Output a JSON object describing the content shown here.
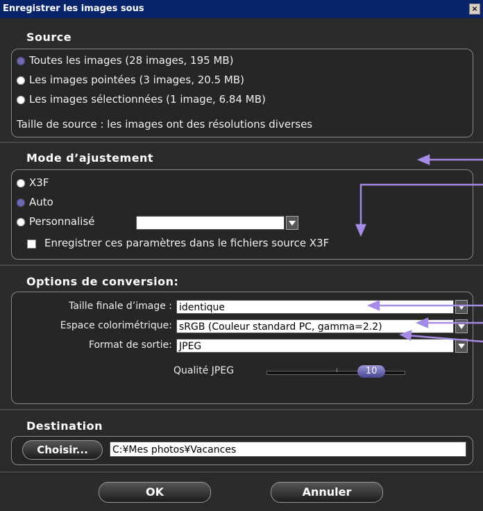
{
  "window": {
    "title": "Enregistrer les images sous",
    "close_glyph": "×"
  },
  "source": {
    "title": "Source",
    "options": [
      {
        "label": "Toutes les images (28 images, 195 MB)",
        "selected": true
      },
      {
        "label": "Les images pointées (3 images, 20.5 MB)",
        "selected": false
      },
      {
        "label": "Les images sélectionnées (1 image, 6.84 MB)",
        "selected": false
      }
    ],
    "note": "Taille de source : les images ont des résolutions diverses"
  },
  "mode": {
    "title": "Mode d’ajustement",
    "options": [
      {
        "label": "X3F",
        "selected": false
      },
      {
        "label": "Auto",
        "selected": true
      },
      {
        "label": "Personnalisé",
        "selected": false
      }
    ],
    "custom_value": "",
    "save_checkbox_label": "Enregistrer ces paramètres dans le fichiers source X3F",
    "save_checked": false
  },
  "conversion": {
    "title": "Options de conversion:",
    "size_label": "Taille finale d’image :",
    "size_value": "identique",
    "colorspace_label": "Espace colorimétrique:",
    "colorspace_value": "sRGB (Couleur standard PC, gamma=2.2)",
    "format_label": "Format de sortie:",
    "format_value": "JPEG",
    "quality_label": "Qualité JPEG",
    "quality_value": "10",
    "quality_fraction": 0.83
  },
  "destination": {
    "title": "Destination",
    "choose_label": "Choisir...",
    "path": "C:¥Mes photos¥Vacances"
  },
  "buttons": {
    "ok": "OK",
    "cancel": "Annuler"
  },
  "colors": {
    "accent": "#6d6ab0",
    "arrow": "#a58be6",
    "titlebar": "#0a246a",
    "background": "#2b2b2b"
  }
}
